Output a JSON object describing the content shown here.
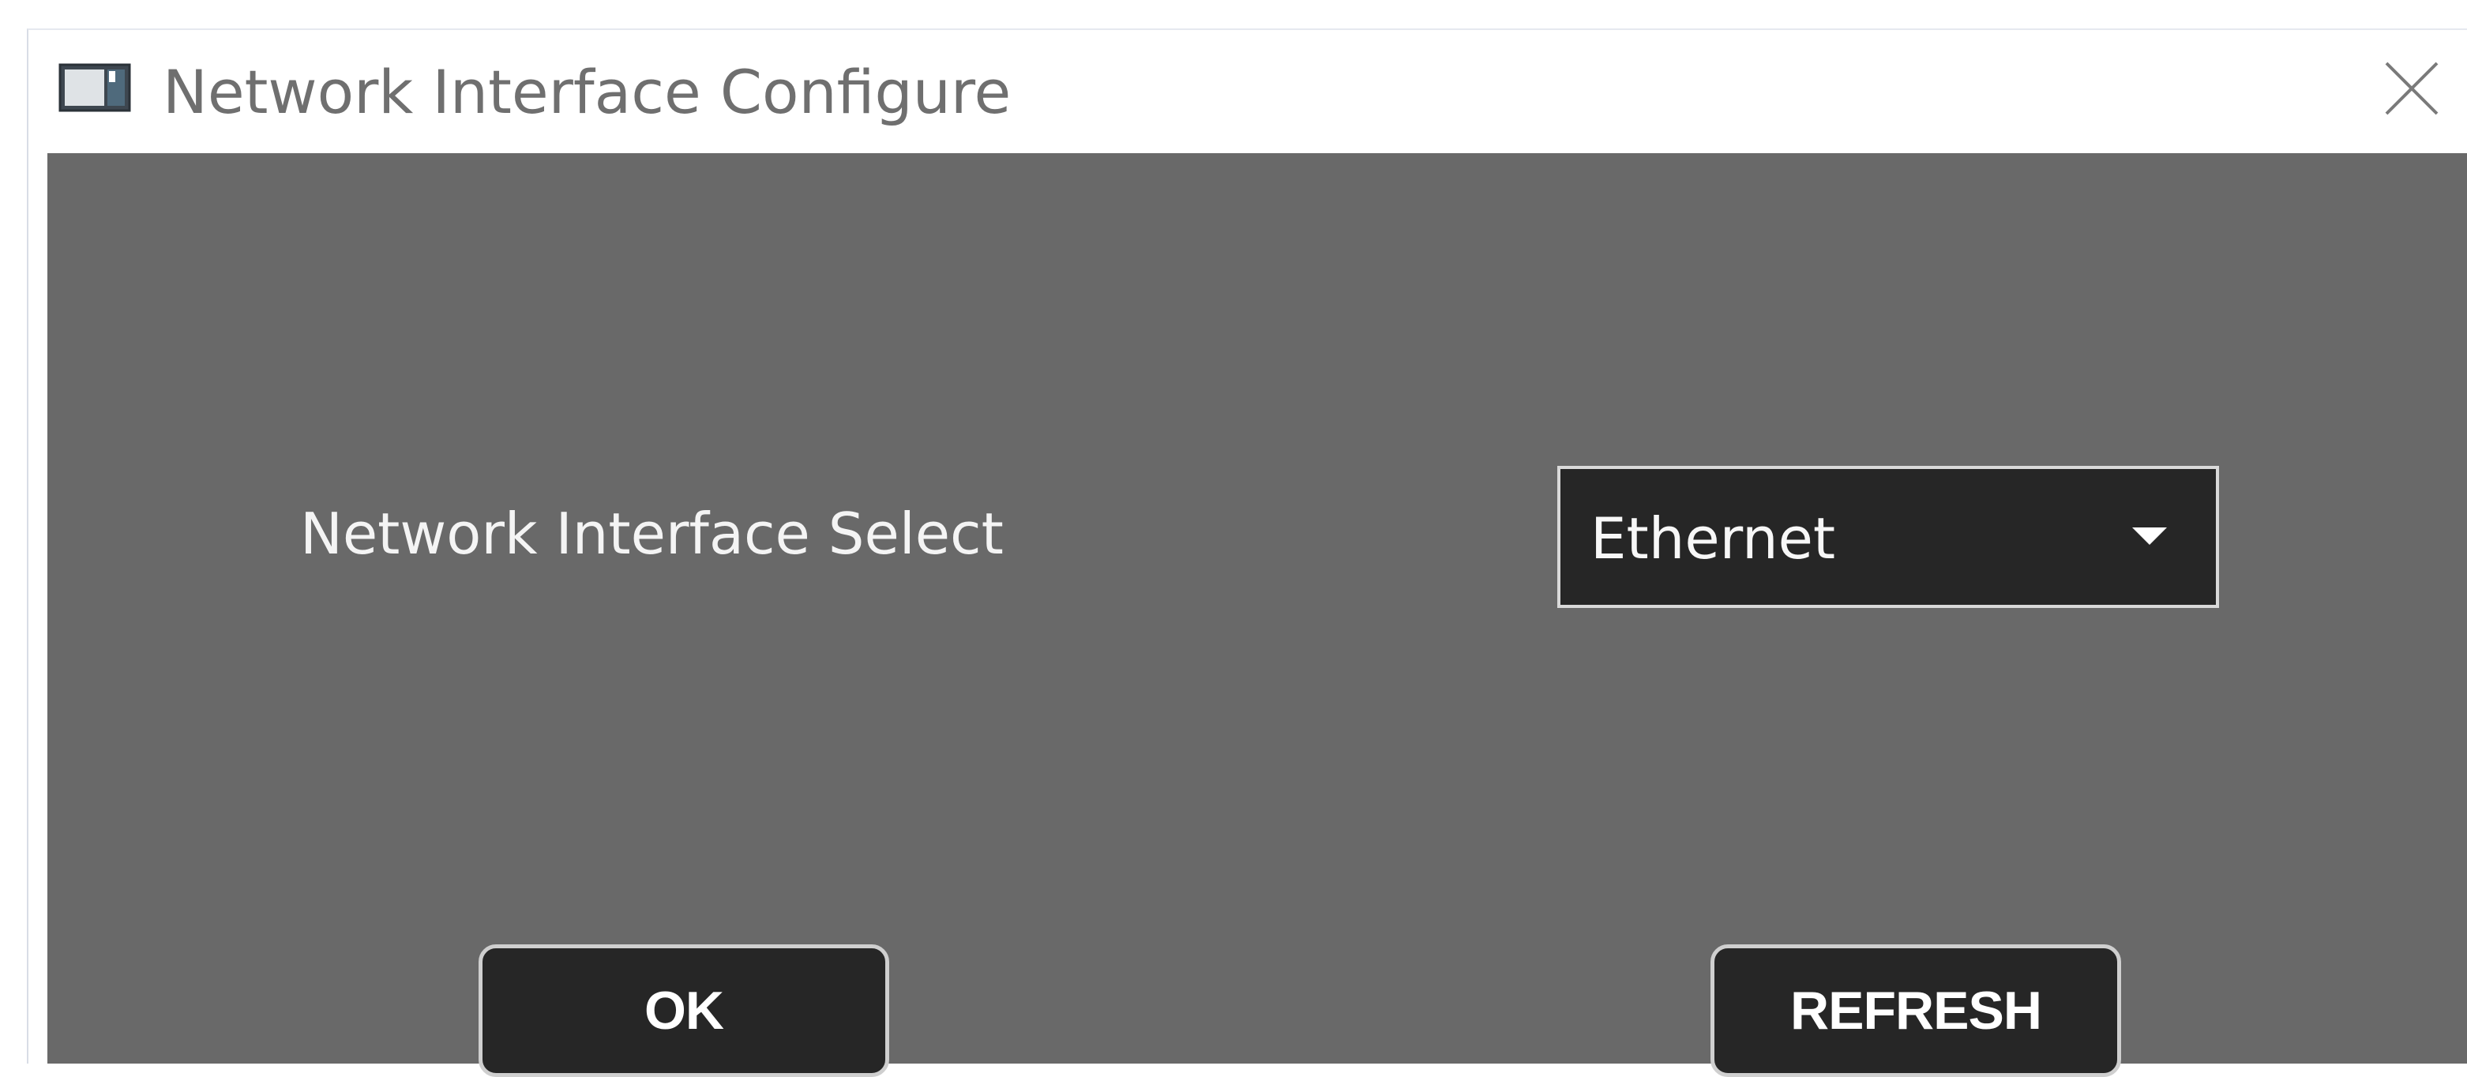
{
  "window": {
    "title": "Network Interface Configure",
    "icon": "app-window-icon",
    "close_icon": "close-icon"
  },
  "form": {
    "interface_label": "Network Interface Select",
    "interface_select": {
      "selected": "Ethernet",
      "icon": "chevron-down-icon"
    }
  },
  "buttons": {
    "ok_label": "OK",
    "refresh_label": "REFRESH"
  },
  "colors": {
    "content_background": "#696969",
    "control_background": "#262626",
    "control_border": "#d9d9d9",
    "title_text": "#6f6f6f"
  }
}
